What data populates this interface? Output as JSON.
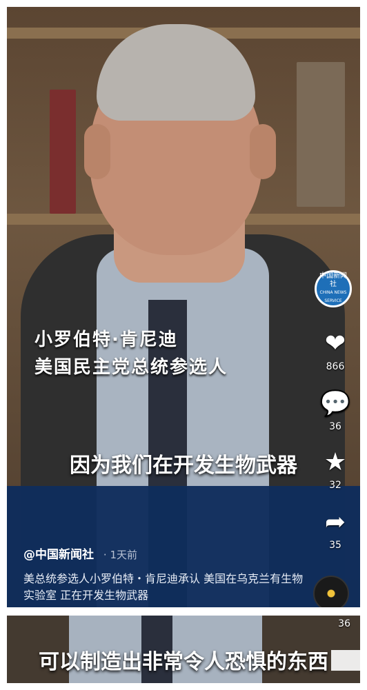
{
  "video1": {
    "person_name": "小罗伯特·肯尼迪",
    "person_title": "美国民主党总统参选人",
    "subtitle": "因为我们在开发生物武器",
    "author": "@中国新闻社",
    "time_ago": "· 1天前",
    "description": "美总统参选人小罗伯特・肯尼迪承认 美国在乌克兰有生物实验室 正在开发生物武器",
    "likes": "866",
    "comments": "36",
    "favorites": "32",
    "shares": "35",
    "logo_text": "中国新闻社",
    "logo_en": "CHINA NEWS SERVICE"
  },
  "video2": {
    "subtitle": "可以制造出非常令人恐惧的东西",
    "count": "36"
  },
  "icons": {
    "like": "heart-icon",
    "comment": "comment-icon",
    "favorite": "star-icon",
    "share": "share-icon",
    "music": "music-disc-icon"
  }
}
